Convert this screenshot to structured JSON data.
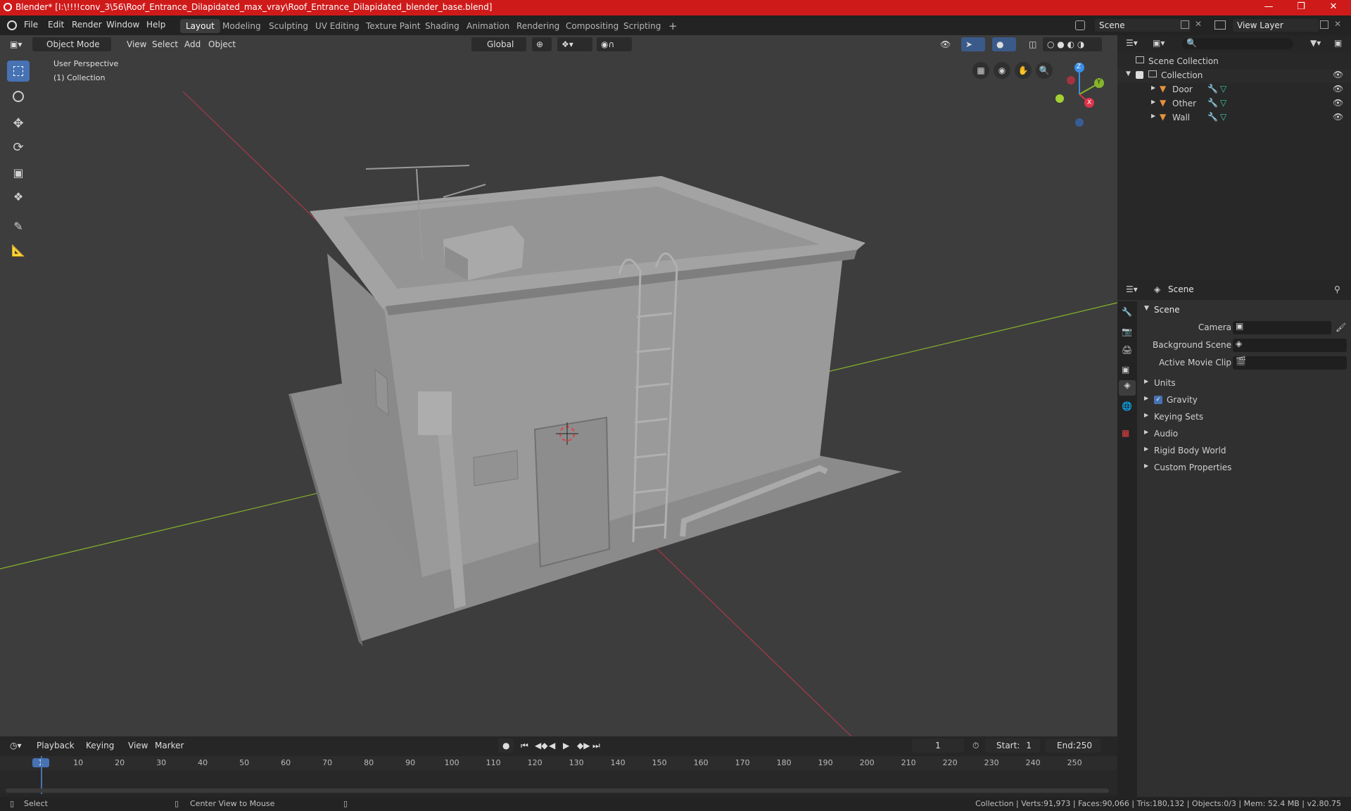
{
  "window": {
    "title": "Blender* [I:\\!!!!conv_3\\56\\Roof_Entrance_Dilapidated_max_vray\\Roof_Entrance_Dilapidated_blender_base.blend]"
  },
  "menu": [
    "File",
    "Edit",
    "Render",
    "Window",
    "Help"
  ],
  "workspaces": [
    "Layout",
    "Modeling",
    "Sculpting",
    "UV Editing",
    "Texture Paint",
    "Shading",
    "Animation",
    "Rendering",
    "Compositing",
    "Scripting"
  ],
  "scene_field": "Scene",
  "view_layer_field": "View Layer",
  "viewport": {
    "mode": "Object Mode",
    "menus": [
      "View",
      "Select",
      "Add",
      "Object"
    ],
    "orientation": "Global",
    "overlay_title": "User Perspective",
    "overlay_subtitle": "(1) Collection",
    "gizmo_axes": {
      "x": "X",
      "y": "Y",
      "z": "Z"
    }
  },
  "outliner": {
    "root": "Scene Collection",
    "collection": "Collection",
    "items": [
      "Door",
      "Other",
      "Wall"
    ]
  },
  "properties": {
    "context": "Scene",
    "panel": "Scene",
    "fields": [
      {
        "label": "Camera",
        "value": ""
      },
      {
        "label": "Background Scene",
        "value": ""
      },
      {
        "label": "Active Movie Clip",
        "value": ""
      }
    ],
    "sections": [
      "Units",
      "Gravity",
      "Keying Sets",
      "Audio",
      "Rigid Body World",
      "Custom Properties"
    ],
    "gravity_checked": true
  },
  "timeline": {
    "menus": [
      "Playback",
      "Keying",
      "View",
      "Marker"
    ],
    "current_frame": "1",
    "start_label": "Start:",
    "start": "1",
    "end_label": "End:",
    "end": "250",
    "ticks": [
      "1",
      "10",
      "20",
      "30",
      "40",
      "50",
      "60",
      "70",
      "80",
      "90",
      "100",
      "110",
      "120",
      "130",
      "140",
      "150",
      "160",
      "170",
      "180",
      "190",
      "200",
      "210",
      "220",
      "230",
      "240",
      "250"
    ]
  },
  "status": {
    "left": "Select",
    "middle": "Center View to Mouse",
    "right": "Collection | Verts:91,973 | Faces:90,066 | Tris:180,132 | Objects:0/3 | Mem: 52.4 MB | v2.80.75"
  },
  "colors": {
    "titlebar": "#cf1a1a",
    "accent": "#4772b3",
    "viewport_bg": "#3d3d3d",
    "x_axis": "#e0334b",
    "y_axis": "#86b52b",
    "z_axis": "#3a8ee6"
  }
}
